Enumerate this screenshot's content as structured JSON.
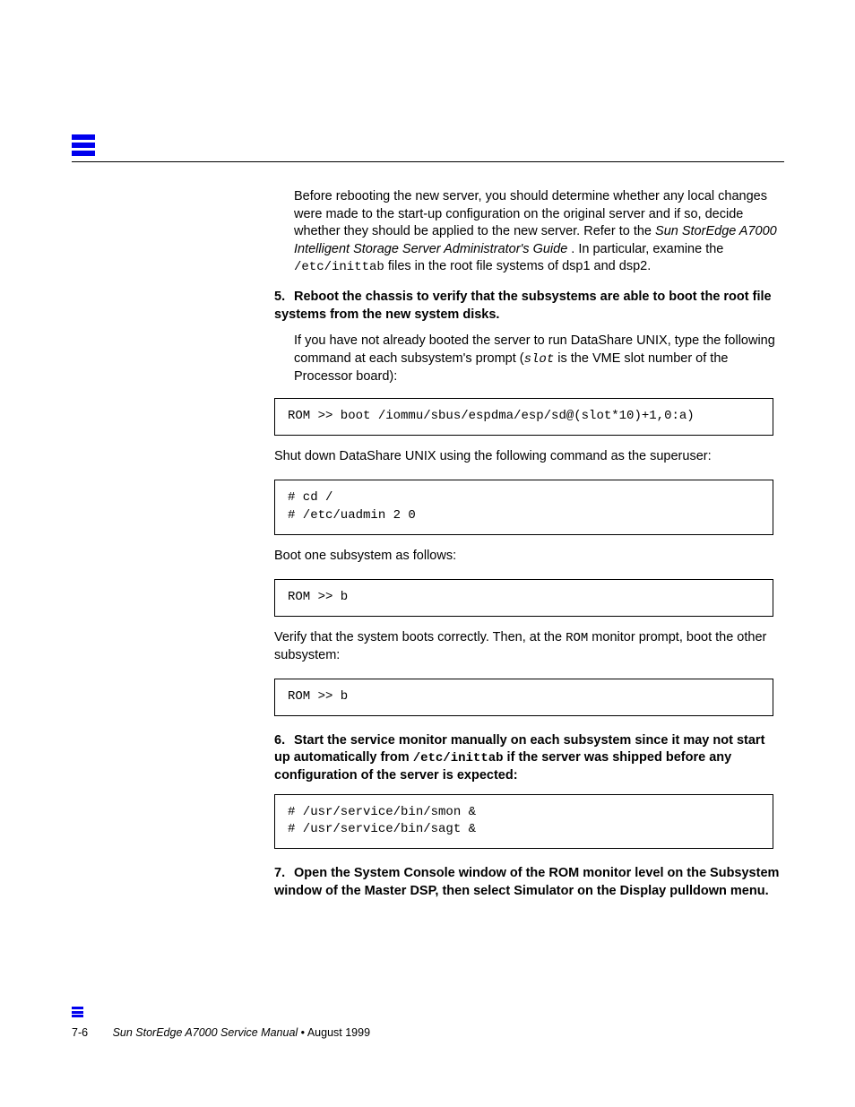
{
  "para1_lead": "Before rebooting the new server, you should determine whether any local changes were made to the start-up configuration on the original server and if so, decide whether they should be applied to the new server. Refer to the ",
  "para1_ital": "Sun StorEdge A7000 Intelligent Storage Server Administrator's Guide",
  "para1_tail": ". In particular, examine the ",
  "para1_code": "/etc/inittab",
  "para1_after": " files in the root file systems of dsp1 and dsp2.",
  "step5": {
    "num": "5.",
    "text": "Reboot the chassis to verify that the subsystems are able to boot the root file systems from the new system disks."
  },
  "para2_lead": "If you have not already booted the server to run DataShare UNIX, type the following command at each subsystem's prompt (",
  "para2_code": "slot",
  "para2_after": " is the VME slot number of the Processor board):",
  "cmd1": "ROM >> boot /iommu/sbus/espdma/esp/sd@(slot*10)+1,0:a)",
  "para3": "Shut down DataShare UNIX using the following command as the superuser:",
  "cmd2": "# cd /\n# /etc/uadmin 2 0",
  "para4": "Boot one subsystem as follows:",
  "cmd3": "ROM >> b",
  "para5_lead": "Verify that the system boots correctly. Then, at the ",
  "para5_code": "ROM",
  "para5_after": " monitor prompt, boot the other subsystem:",
  "cmd4": "ROM >> b",
  "step6": {
    "num": "6.",
    "text1": "Start the service monitor manually on each subsystem since it may not start up automatically from ",
    "code": "/etc/inittab",
    "text2": " if the server was shipped before any configuration of the server is expected:"
  },
  "cmd5": "# /usr/service/bin/smon &\n# /usr/service/bin/sagt &",
  "step7": {
    "num": "7.",
    "text": "Open the System Console window of the ROM monitor level on the Subsystem window of the Master DSP, then select Simulator on the Display pulldown menu."
  },
  "footer": {
    "page": "7-6",
    "title": "Sun StorEdge A7000 Service Manual",
    "date": "August 1999"
  }
}
